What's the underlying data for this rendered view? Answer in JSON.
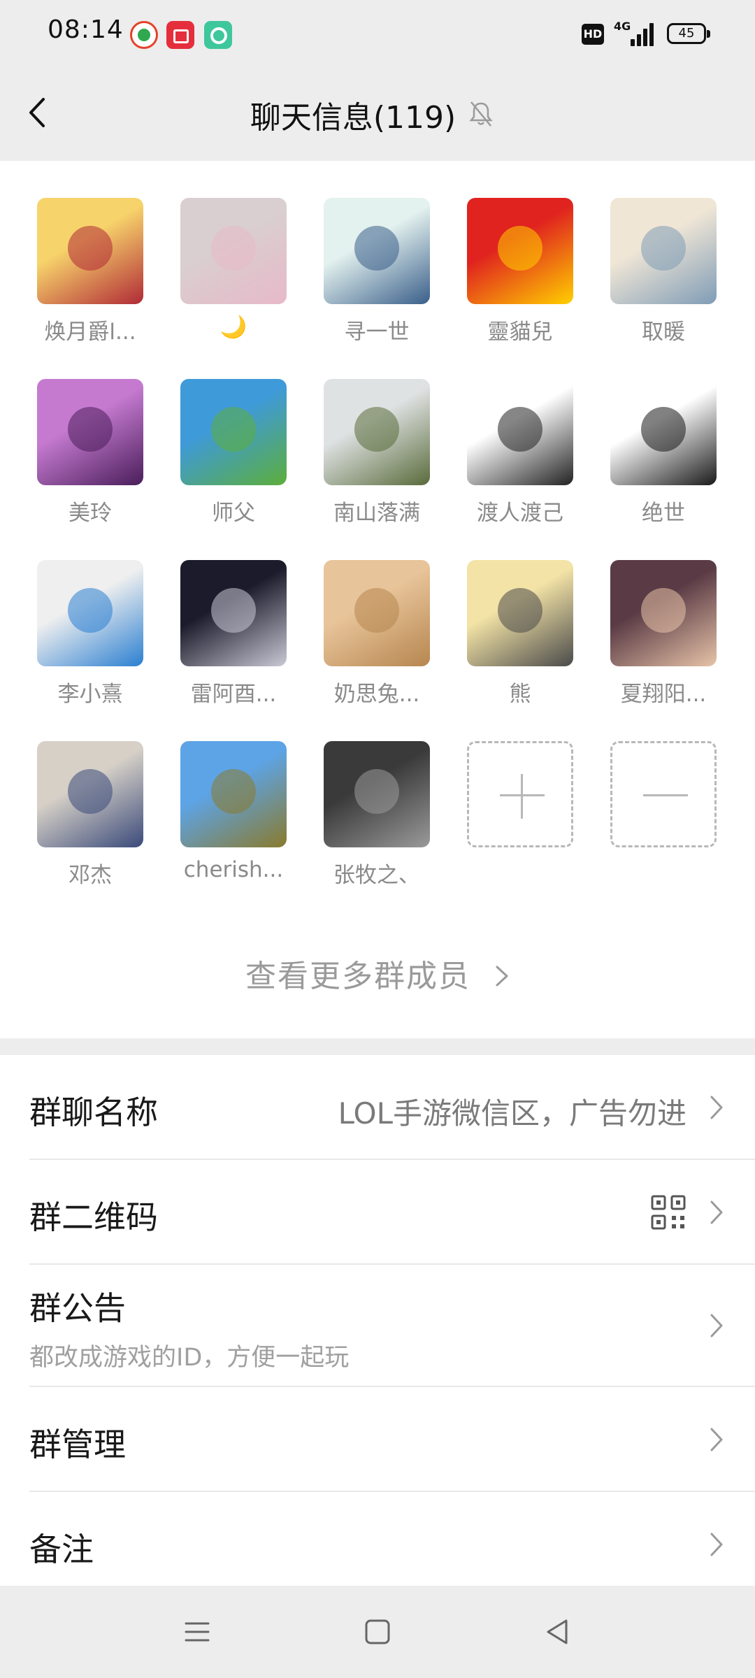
{
  "status_bar": {
    "time": "08:14",
    "hd": "HD",
    "network": "4G",
    "battery": "45"
  },
  "header": {
    "title": "聊天信息(119)"
  },
  "members": [
    {
      "name": "焕月爵l...",
      "avatar_colors": [
        "#f7d36b",
        "#b02a36"
      ]
    },
    {
      "name": "🌙",
      "avatar_colors": [
        "#d9cfd0",
        "#e7b9c9"
      ]
    },
    {
      "name": "寻一世",
      "avatar_colors": [
        "#e4f2ef",
        "#3a5f8a"
      ]
    },
    {
      "name": "靈貓兒",
      "avatar_colors": [
        "#e0231f",
        "#ffd000"
      ]
    },
    {
      "name": "取暖",
      "avatar_colors": [
        "#f0e6d6",
        "#7f9cb6"
      ]
    },
    {
      "name": "美玲",
      "avatar_colors": [
        "#c57ad0",
        "#4a1e5a"
      ]
    },
    {
      "name": "师父",
      "avatar_colors": [
        "#3f9ad9",
        "#5cae3a"
      ]
    },
    {
      "name": "南山落满",
      "avatar_colors": [
        "#dfe2e3",
        "#5a6b3b"
      ]
    },
    {
      "name": "渡人渡己",
      "avatar_colors": [
        "#ffffff",
        "#222222"
      ]
    },
    {
      "name": "绝世",
      "avatar_colors": [
        "#ffffff",
        "#1a1a1a"
      ]
    },
    {
      "name": "李小熹",
      "avatar_colors": [
        "#efefef",
        "#2b7fd1"
      ]
    },
    {
      "name": "雷阿酉...",
      "avatar_colors": [
        "#1b1b2b",
        "#c9c9d6"
      ]
    },
    {
      "name": "奶思兔...",
      "avatar_colors": [
        "#e8c49a",
        "#b6864f"
      ]
    },
    {
      "name": "熊",
      "avatar_colors": [
        "#f3e3a6",
        "#4a4a4a"
      ]
    },
    {
      "name": "夏翔阳...",
      "avatar_colors": [
        "#5a3b45",
        "#e7c3a8"
      ]
    },
    {
      "name": "邓杰",
      "avatar_colors": [
        "#d6d0c7",
        "#3a4a7a"
      ]
    },
    {
      "name": "cherish...",
      "avatar_colors": [
        "#5da4e6",
        "#8a7a2c"
      ]
    },
    {
      "name": "张牧之、",
      "avatar_colors": [
        "#3a3a3a",
        "#9a9a9a"
      ]
    }
  ],
  "view_more": "查看更多群成员",
  "settings": {
    "group_name_label": "群聊名称",
    "group_name_value": "LOL手游微信区，广告勿进",
    "qr_label": "群二维码",
    "announcement_label": "群公告",
    "announcement_value": "都改成游戏的ID，方便一起玩",
    "manage_label": "群管理",
    "note_label": "备注"
  }
}
